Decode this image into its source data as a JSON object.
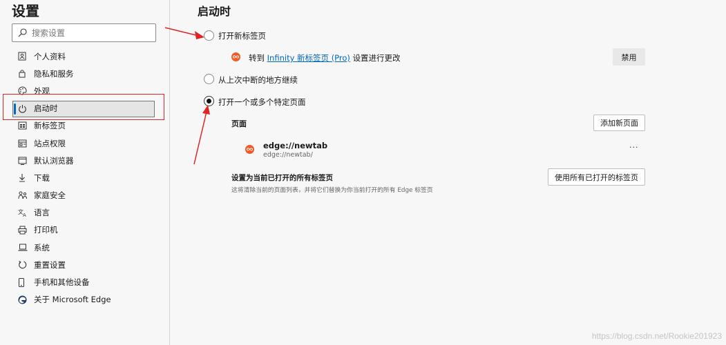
{
  "sidebar": {
    "title": "设置",
    "search_placeholder": "搜索设置",
    "items": [
      {
        "label": "个人资料",
        "icon": "profile-icon"
      },
      {
        "label": "隐私和服务",
        "icon": "lock-icon"
      },
      {
        "label": "外观",
        "icon": "palette-icon"
      },
      {
        "label": "启动时",
        "icon": "power-icon",
        "active": true
      },
      {
        "label": "新标签页",
        "icon": "new-tab-icon"
      },
      {
        "label": "站点权限",
        "icon": "site-permissions-icon"
      },
      {
        "label": "默认浏览器",
        "icon": "browser-icon"
      },
      {
        "label": "下载",
        "icon": "download-icon"
      },
      {
        "label": "家庭安全",
        "icon": "family-icon"
      },
      {
        "label": "语言",
        "icon": "language-icon"
      },
      {
        "label": "打印机",
        "icon": "printer-icon"
      },
      {
        "label": "系统",
        "icon": "laptop-icon"
      },
      {
        "label": "重置设置",
        "icon": "reset-icon"
      },
      {
        "label": "手机和其他设备",
        "icon": "phone-icon"
      },
      {
        "label": "关于 Microsoft Edge",
        "icon": "edge-logo-icon"
      }
    ]
  },
  "main": {
    "title": "启动时",
    "option_new_tab": "打开新标签页",
    "extension_note_prefix": "转到",
    "extension_link": "Infinity 新标签页 (Pro)",
    "extension_note_suffix": "设置进行更改",
    "disable_button": "禁用",
    "option_continue": "从上次中断的地方继续",
    "option_specific": "打开一个或多个特定页面",
    "pages_label": "页面",
    "add_page_button": "添加新页面",
    "page_entry": {
      "title": "edge://newtab",
      "url": "edge://newtab/"
    },
    "more_options": "···",
    "use_all_title": "设置为当前已打开的所有标签页",
    "use_all_desc": "这将清除当前的页面列表，并将它们替换为你当前打开的所有 Edge 标签页",
    "use_all_button": "使用所有已打开的标签页"
  },
  "watermark": "https://blog.csdn.net/Rookie201923",
  "colors": {
    "accent": "#0067c0",
    "annotation_red": "#e02424",
    "infinity_orange": "#f05a28"
  }
}
